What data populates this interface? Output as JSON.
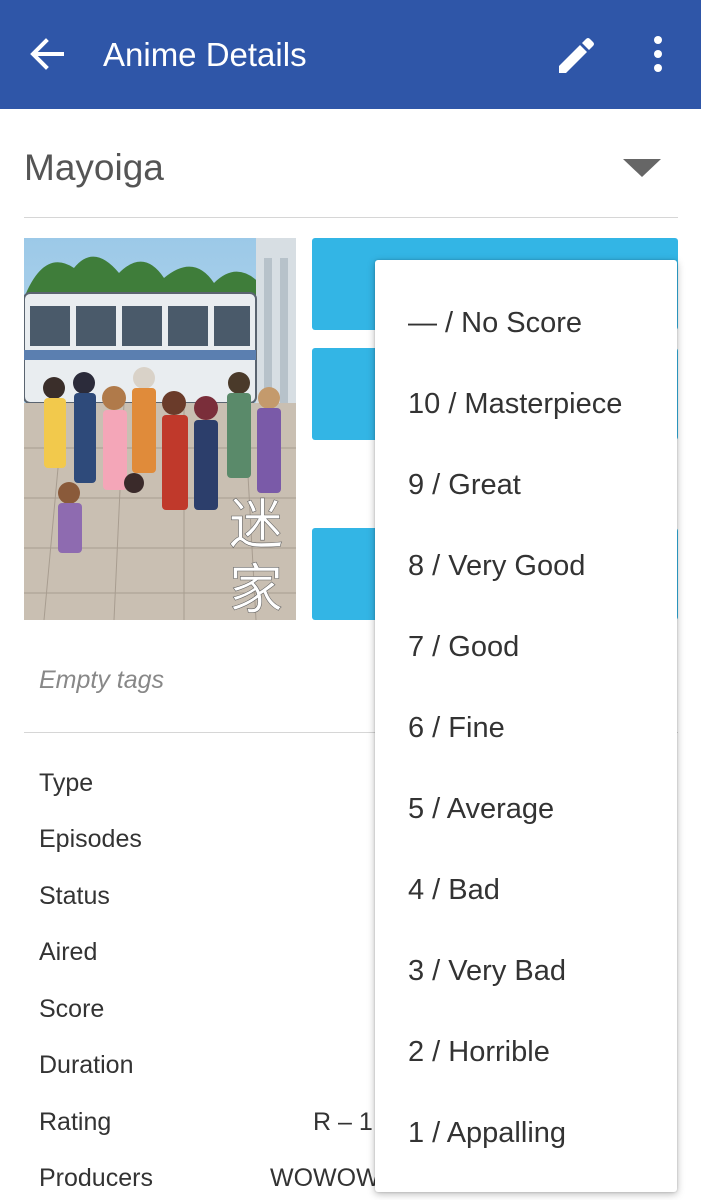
{
  "appbar": {
    "title": "Anime Details",
    "back_icon": "arrow-left-icon",
    "edit_icon": "pencil-icon",
    "more_icon": "more-vertical-icon",
    "color": "#2f56a8"
  },
  "series": {
    "title": "Mayoiga",
    "poster_text": "迷家"
  },
  "tags": {
    "empty_text": "Empty tags"
  },
  "info": {
    "labels": [
      "Type",
      "Episodes",
      "Status",
      "Aired",
      "Score",
      "Duration",
      "Rating",
      "Producers"
    ],
    "rating_value_visible": "R – 1",
    "producers_value_visible": "WOWOW"
  },
  "score_menu": {
    "options": [
      "— / No Score",
      "10 / Masterpiece",
      "9 / Great",
      "8 / Very Good",
      "7 / Good",
      "6 / Fine",
      "5 / Average",
      "4 / Bad",
      "3 / Very Bad",
      "2 / Horrible",
      "1 / Appalling"
    ]
  },
  "colors": {
    "accent_button": "#33b5e5",
    "divider": "#d6d6d6"
  }
}
